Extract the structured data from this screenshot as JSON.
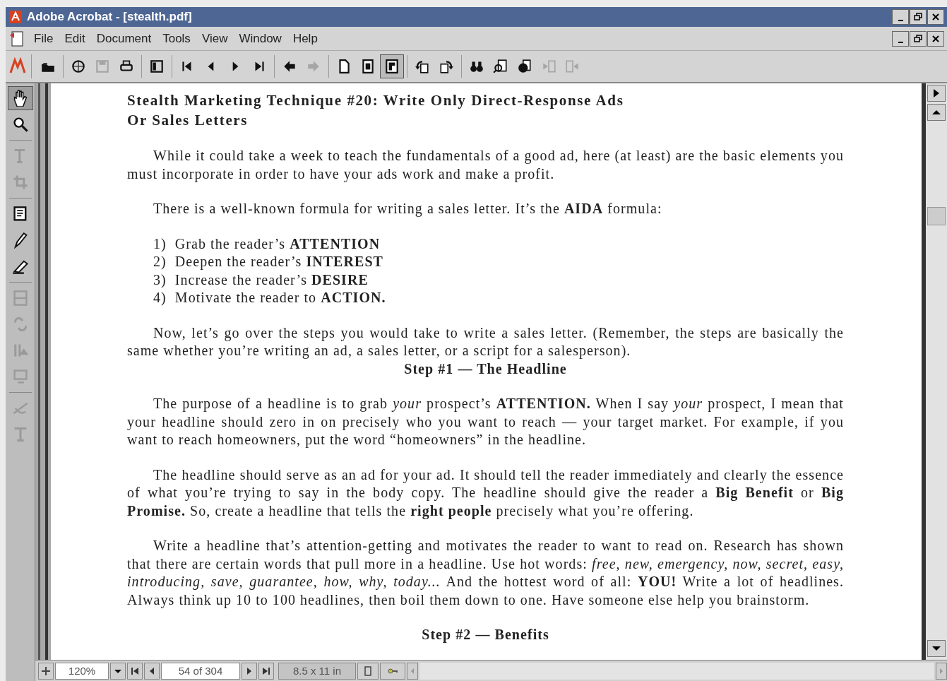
{
  "window": {
    "title": "Adobe Acrobat - [stealth.pdf]"
  },
  "menu": [
    "File",
    "Edit",
    "Document",
    "Tools",
    "View",
    "Window",
    "Help"
  ],
  "toolbar": [
    {
      "disabled": false,
      "selected": false
    },
    {
      "disabled": false,
      "selected": false
    },
    {
      "disabled": true,
      "selected": false
    },
    {
      "disabled": false,
      "selected": false
    },
    {
      "disabled": false,
      "selected": false
    },
    {
      "disabled": false,
      "selected": false
    },
    {
      "disabled": false,
      "selected": false
    },
    {
      "disabled": false,
      "selected": false
    },
    {
      "disabled": false,
      "selected": false
    },
    {
      "disabled": false,
      "selected": false
    },
    {
      "disabled": true,
      "selected": false
    },
    {
      "disabled": false,
      "selected": false
    },
    {
      "disabled": false,
      "selected": false
    },
    {
      "disabled": false,
      "selected": true
    },
    {
      "disabled": false,
      "selected": false
    },
    {
      "disabled": false,
      "selected": false
    },
    {
      "disabled": false,
      "selected": false
    },
    {
      "disabled": false,
      "selected": false
    },
    {
      "disabled": false,
      "selected": false
    },
    {
      "disabled": true,
      "selected": false
    },
    {
      "disabled": true,
      "selected": false
    }
  ],
  "tools": [
    {
      "disabled": false,
      "selected": true
    },
    {
      "disabled": false,
      "selected": false
    },
    {
      "disabled": true,
      "selected": false
    },
    {
      "disabled": true,
      "selected": false
    },
    {
      "disabled": false,
      "selected": false
    },
    {
      "disabled": false,
      "selected": false
    },
    {
      "disabled": false,
      "selected": false
    },
    {
      "disabled": true,
      "selected": false
    },
    {
      "disabled": true,
      "selected": false
    },
    {
      "disabled": true,
      "selected": false
    },
    {
      "disabled": true,
      "selected": false
    },
    {
      "disabled": true,
      "selected": false
    },
    {
      "disabled": true,
      "selected": false
    }
  ],
  "document": [
    {
      "kind": "title",
      "text": "Stealth Marketing Technique #20:  Write Only Direct-Response Ads"
    },
    {
      "kind": "title",
      "text": "Or Sales Letters"
    },
    {
      "kind": "paragraph",
      "text": "While it could take a week to teach the fundamentals of a good ad, here (at least) are the basic elements you must incorporate in order to have your ads work and make a profit."
    },
    {
      "kind": "paragraph",
      "text": "There is a well-known formula for writing a sales letter.  It’s the **AIDA** formula:"
    },
    {
      "kind": "list",
      "items": [
        "1)  Grab the reader’s **ATTENTION**",
        "2)  Deepen the reader’s **INTEREST**",
        "3)  Increase the reader’s **DESIRE**",
        "4)  Motivate the reader to **ACTION.**"
      ]
    },
    {
      "kind": "paragraph",
      "text": "Now, let’s go over the steps you would take to write a sales letter.  (Remember, the steps are basically the same whether you’re writing an ad, a sales letter, or a script for a salesperson)."
    },
    {
      "kind": "step",
      "text": "Step #1 — The Headline"
    },
    {
      "kind": "paragraph",
      "text": "The purpose of a headline is to grab *your* prospect’s **ATTENTION.**  When I say *your* prospect, I mean that your headline should zero in on precisely who you want to reach — your target market.  For example, if you want to reach homeowners, put the word “homeowners” in the headline."
    },
    {
      "kind": "paragraph",
      "text": "The headline should serve as an ad for your ad.  It should tell the reader immediately and clearly the essence of what you’re trying to say in the body copy.  The headline should give the reader a **Big Benefit** or **Big Promise.**  So, create a headline that tells the **right people** precisely what you’re offering."
    },
    {
      "kind": "paragraph",
      "text": "Write a headline that’s attention-getting and motivates the reader to want to read on.  Research has shown that there are certain words that pull more in a headline.  Use hot words:  *free, new, emergency, now, secret, easy, introducing, save, guarantee, how, why, today...*  And the hottest word of all:  **YOU!**  Write a lot of headlines.  Always think up 10 to 100 headlines, then boil them down to one.  Have someone else help you brainstorm."
    },
    {
      "kind": "step",
      "text": "Step #2 — Benefits"
    }
  ],
  "status_bar": {
    "zoom": "120%",
    "page": "54 of 304",
    "page_size": "8.5 x 11 in"
  }
}
